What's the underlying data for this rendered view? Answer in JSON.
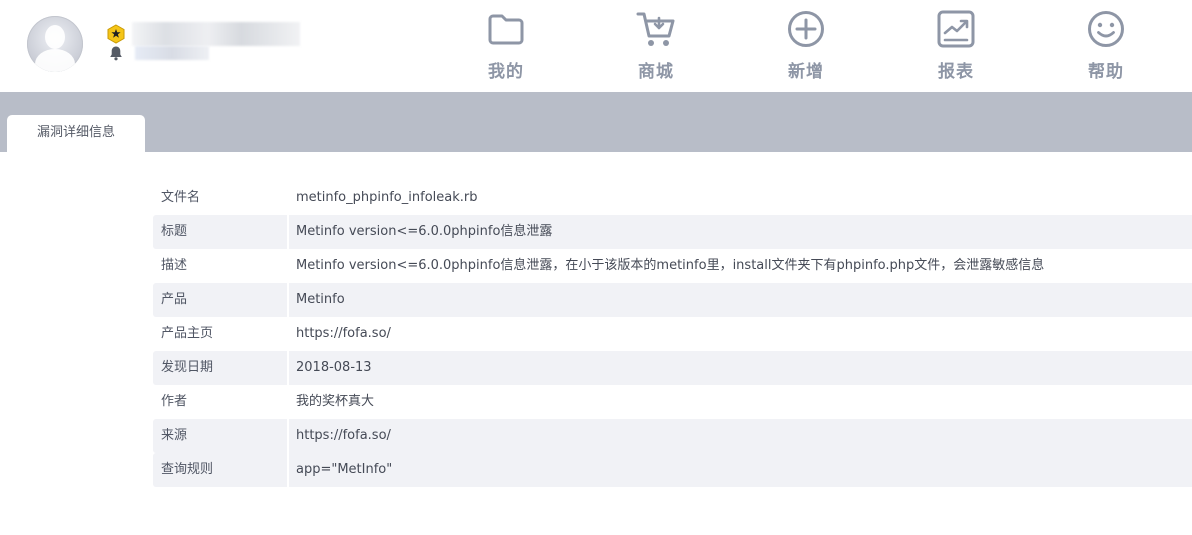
{
  "header": {
    "user_name": "",
    "user_sub": "",
    "nav": [
      {
        "label": "我的",
        "icon": "folder-icon"
      },
      {
        "label": "商城",
        "icon": "cart-icon"
      },
      {
        "label": "新增",
        "icon": "plus-circle-icon"
      },
      {
        "label": "报表",
        "icon": "report-icon"
      },
      {
        "label": "帮助",
        "icon": "smiley-icon"
      }
    ]
  },
  "tabs": [
    {
      "label": "漏洞详细信息"
    }
  ],
  "detail": [
    {
      "label": "文件名",
      "value": "metinfo_phpinfo_infoleak.rb"
    },
    {
      "label": "标题",
      "value": "Metinfo version<=6.0.0phpinfo信息泄露"
    },
    {
      "label": "描述",
      "value": "Metinfo version<=6.0.0phpinfo信息泄露，在小于该版本的metinfo里，install文件夹下有phpinfo.php文件，会泄露敏感信息"
    },
    {
      "label": "产品",
      "value": "Metinfo"
    },
    {
      "label": "产品主页",
      "value": "https://fofa.so/"
    },
    {
      "label": "发现日期",
      "value": "2018-08-13"
    },
    {
      "label": "作者",
      "value": "我的奖杯真大"
    },
    {
      "label": "来源",
      "value": "https://fofa.so/"
    },
    {
      "label": "查询规则",
      "value": "app=\"MetInfo\""
    }
  ],
  "colors": {
    "accent_gray": "#8e96a6",
    "tabbar_bg": "#b8bdc8",
    "row_alt_bg": "#f1f2f6",
    "badge_gold": "#f5c518"
  }
}
